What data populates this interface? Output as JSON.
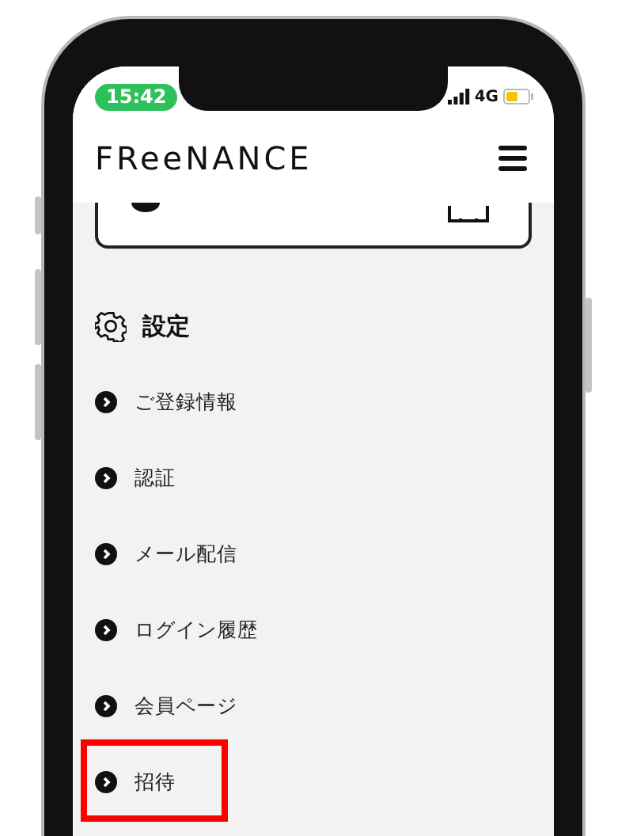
{
  "status_bar": {
    "time": "15:42",
    "network": "4G"
  },
  "header": {
    "logo": "FReeNANCE"
  },
  "section": {
    "title": "設定"
  },
  "items": [
    {
      "label": "ご登録情報",
      "highlighted": false
    },
    {
      "label": "認証",
      "highlighted": false
    },
    {
      "label": "メール配信",
      "highlighted": false
    },
    {
      "label": "ログイン履歴",
      "highlighted": false
    },
    {
      "label": "会員ページ",
      "highlighted": false
    },
    {
      "label": "招待",
      "highlighted": true
    }
  ]
}
